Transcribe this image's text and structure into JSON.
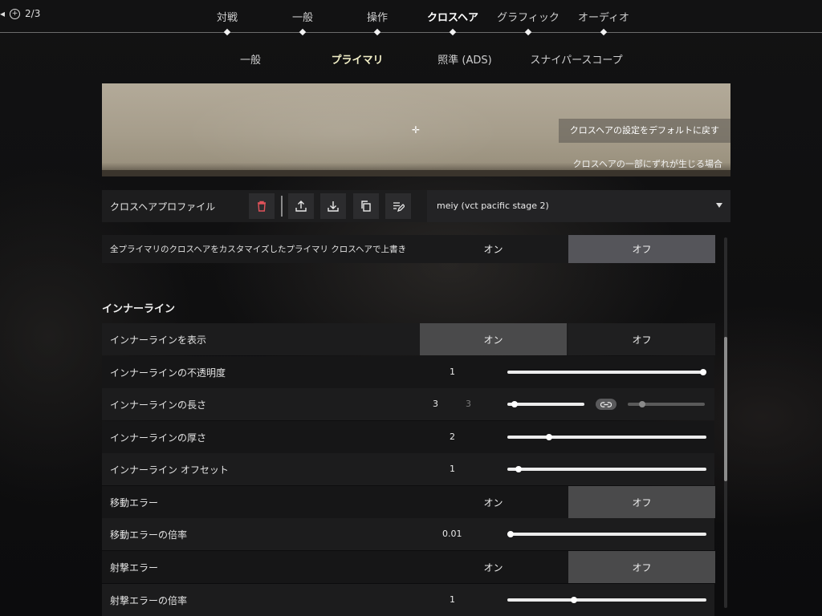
{
  "page_counter": "2/3",
  "tabs": [
    {
      "label": "対戦"
    },
    {
      "label": "一般"
    },
    {
      "label": "操作"
    },
    {
      "label": "クロスヘア",
      "active": true
    },
    {
      "label": "グラフィック"
    },
    {
      "label": "オーディオ"
    }
  ],
  "subtabs": [
    {
      "label": "一般"
    },
    {
      "label": "プライマリ",
      "active": true
    },
    {
      "label": "照準 (ADS)"
    },
    {
      "label": "スナイパースコープ"
    }
  ],
  "preview": {
    "reset_button": "クロスヘアの設定をデフォルトに戻す",
    "note": "クロスヘアの一部にずれが生じる場合"
  },
  "profile": {
    "label": "クロスヘアプロファイル",
    "selected": "meiy (vct pacific stage 2)"
  },
  "override": {
    "label": "全プライマリのクロスヘアをカスタマイズしたプライマリ クロスヘアで上書き",
    "on": "オン",
    "off": "オフ",
    "selected": "off"
  },
  "section_title": "インナーライン",
  "settings": {
    "show": {
      "label": "インナーラインを表示",
      "on": "オン",
      "off": "オフ",
      "selected": "on"
    },
    "opacity": {
      "label": "インナーラインの不透明度",
      "value": "1",
      "fraction": 1.0
    },
    "length": {
      "label": "インナーラインの長さ",
      "value": "3",
      "value2": "3",
      "fraction": 0.06,
      "fraction2": 0.16
    },
    "thickness": {
      "label": "インナーラインの厚さ",
      "value": "2",
      "fraction": 0.2
    },
    "offset": {
      "label": "インナーライン オフセット",
      "value": "1",
      "fraction": 0.04
    },
    "move_error": {
      "label": "移動エラー",
      "on": "オン",
      "off": "オフ",
      "selected": "off"
    },
    "move_mult": {
      "label": "移動エラーの倍率",
      "value": "0.01",
      "fraction": 0.0
    },
    "fire_error": {
      "label": "射撃エラー",
      "on": "オン",
      "off": "オフ",
      "selected": "off"
    },
    "fire_mult": {
      "label": "射撃エラーの倍率",
      "value": "1",
      "fraction": 0.33
    }
  },
  "colors": {
    "accent_subtab": "#f3f0c8",
    "selected_toggle": "#4a4a4b",
    "delete_icon": "#e0525a"
  }
}
